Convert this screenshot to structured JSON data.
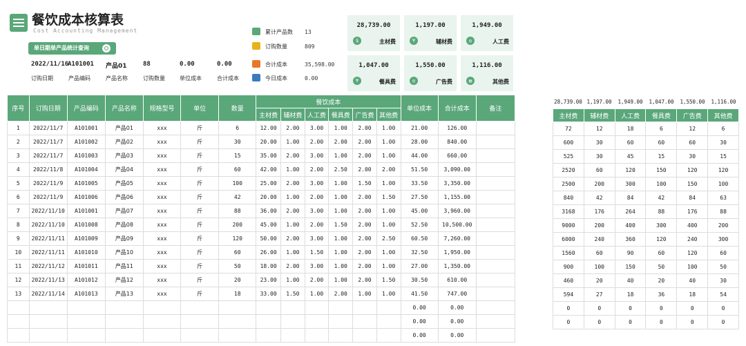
{
  "header": {
    "title": "餐饮成本核算表",
    "subtitle": "Cost Accounting Management",
    "query_button": "单日期单产品统计查询"
  },
  "query": {
    "date": "2022/11/16",
    "code": "A101001",
    "name": "产品01",
    "qty": "88",
    "unit_cost": "0.00",
    "total_cost": "0.00",
    "labels": [
      "订购日期",
      "产品编码",
      "产品名称",
      "订购数量",
      "单位成本",
      "合计成本"
    ]
  },
  "summary": [
    {
      "label": "累计产品数",
      "value": "13",
      "icon": "stack-icon",
      "color": "#5aa77a"
    },
    {
      "label": "订购数量",
      "value": "809",
      "icon": "box-icon",
      "color": "#e8b21a"
    },
    {
      "label": "合计成本",
      "value": "35,598.00",
      "icon": "cash-icon",
      "color": "#e8772a"
    },
    {
      "label": "今日成本",
      "value": "0.00",
      "icon": "truck-icon",
      "color": "#3a7bbf"
    }
  ],
  "cards": [
    {
      "value": "28,739.00",
      "label": "主材费",
      "glyph": "$"
    },
    {
      "value": "1,197.00",
      "label": "辅材费",
      "glyph": "¥"
    },
    {
      "value": "1,949.00",
      "label": "人工费",
      "glyph": "◎"
    },
    {
      "value": "1,047.00",
      "label": "餐具费",
      "glyph": "¥"
    },
    {
      "value": "1,550.00",
      "label": "广告费",
      "glyph": "◎"
    },
    {
      "value": "1,116.00",
      "label": "其他费",
      "glyph": "▤"
    }
  ],
  "table": {
    "headers": [
      "序号",
      "订购日期",
      "产品编码",
      "产品名称",
      "规格型号",
      "单位",
      "数量",
      "餐饮成本",
      "单位成本",
      "合计成本",
      "备注"
    ],
    "sub_headers": [
      "主材费",
      "辅材费",
      "人工费",
      "餐具费",
      "广告费",
      "其他费"
    ],
    "rows": [
      [
        "1",
        "2022/11/7",
        "A101001",
        "产品01",
        "xxx",
        "斤",
        "6",
        "12.00",
        "2.00",
        "3.00",
        "1.00",
        "2.00",
        "1.00",
        "21.00",
        "126.00",
        ""
      ],
      [
        "2",
        "2022/11/7",
        "A101002",
        "产品02",
        "xxx",
        "斤",
        "30",
        "20.00",
        "1.00",
        "2.00",
        "2.00",
        "2.00",
        "1.00",
        "28.00",
        "840.00",
        ""
      ],
      [
        "3",
        "2022/11/7",
        "A101003",
        "产品03",
        "xxx",
        "斤",
        "15",
        "35.00",
        "2.00",
        "3.00",
        "1.00",
        "2.00",
        "1.00",
        "44.00",
        "660.00",
        ""
      ],
      [
        "4",
        "2022/11/8",
        "A101004",
        "产品04",
        "xxx",
        "斤",
        "60",
        "42.00",
        "1.00",
        "2.00",
        "2.50",
        "2.00",
        "2.00",
        "51.50",
        "3,090.00",
        ""
      ],
      [
        "5",
        "2022/11/9",
        "A101005",
        "产品05",
        "xxx",
        "斤",
        "100",
        "25.00",
        "2.00",
        "3.00",
        "1.00",
        "1.50",
        "1.00",
        "33.50",
        "3,350.00",
        ""
      ],
      [
        "6",
        "2022/11/9",
        "A101006",
        "产品06",
        "xxx",
        "斤",
        "42",
        "20.00",
        "1.00",
        "2.00",
        "1.00",
        "2.00",
        "1.50",
        "27.50",
        "1,155.00",
        ""
      ],
      [
        "7",
        "2022/11/10",
        "A101001",
        "产品07",
        "xxx",
        "斤",
        "88",
        "36.00",
        "2.00",
        "3.00",
        "1.00",
        "2.00",
        "1.00",
        "45.00",
        "3,960.00",
        ""
      ],
      [
        "8",
        "2022/11/10",
        "A101008",
        "产品08",
        "xxx",
        "斤",
        "200",
        "45.00",
        "1.00",
        "2.00",
        "1.50",
        "2.00",
        "1.00",
        "52.50",
        "10,500.00",
        ""
      ],
      [
        "9",
        "2022/11/11",
        "A101009",
        "产品09",
        "xxx",
        "斤",
        "120",
        "50.00",
        "2.00",
        "3.00",
        "1.00",
        "2.00",
        "2.50",
        "60.50",
        "7,260.00",
        ""
      ],
      [
        "10",
        "2022/11/11",
        "A101010",
        "产品10",
        "xxx",
        "斤",
        "60",
        "26.00",
        "1.00",
        "1.50",
        "1.00",
        "2.00",
        "1.00",
        "32.50",
        "1,950.00",
        ""
      ],
      [
        "11",
        "2022/11/12",
        "A101011",
        "产品11",
        "xxx",
        "斤",
        "50",
        "18.00",
        "2.00",
        "3.00",
        "1.00",
        "2.00",
        "1.00",
        "27.00",
        "1,350.00",
        ""
      ],
      [
        "12",
        "2022/11/13",
        "A101012",
        "产品12",
        "xxx",
        "斤",
        "20",
        "23.00",
        "1.00",
        "2.00",
        "1.00",
        "2.00",
        "1.50",
        "30.50",
        "610.00",
        ""
      ],
      [
        "13",
        "2022/11/14",
        "A101013",
        "产品13",
        "xxx",
        "斤",
        "18",
        "33.00",
        "1.50",
        "1.00",
        "2.00",
        "1.00",
        "1.00",
        "41.50",
        "747.00",
        ""
      ],
      [
        "",
        "",
        "",
        "",
        "",
        "",
        "",
        "",
        "",
        "",
        "",
        "",
        "",
        "0.00",
        "0.00",
        ""
      ],
      [
        "",
        "",
        "",
        "",
        "",
        "",
        "",
        "",
        "",
        "",
        "",
        "",
        "",
        "0.00",
        "0.00",
        ""
      ],
      [
        "",
        "",
        "",
        "",
        "",
        "",
        "",
        "",
        "",
        "",
        "",
        "",
        "",
        "0.00",
        "0.00",
        ""
      ]
    ]
  },
  "side_table": {
    "totals": [
      "28,739.00",
      "1,197.00",
      "1,949.00",
      "1,047.00",
      "1,550.00",
      "1,116.00"
    ],
    "headers": [
      "主材费",
      "辅材费",
      "人工费",
      "餐具费",
      "广告费",
      "其他费"
    ],
    "rows": [
      [
        "72",
        "12",
        "18",
        "6",
        "12",
        "6"
      ],
      [
        "600",
        "30",
        "60",
        "60",
        "60",
        "30"
      ],
      [
        "525",
        "30",
        "45",
        "15",
        "30",
        "15"
      ],
      [
        "2520",
        "60",
        "120",
        "150",
        "120",
        "120"
      ],
      [
        "2500",
        "200",
        "300",
        "100",
        "150",
        "100"
      ],
      [
        "840",
        "42",
        "84",
        "42",
        "84",
        "63"
      ],
      [
        "3168",
        "176",
        "264",
        "88",
        "176",
        "88"
      ],
      [
        "9000",
        "200",
        "400",
        "300",
        "400",
        "200"
      ],
      [
        "6000",
        "240",
        "360",
        "120",
        "240",
        "300"
      ],
      [
        "1560",
        "60",
        "90",
        "60",
        "120",
        "60"
      ],
      [
        "900",
        "100",
        "150",
        "50",
        "100",
        "50"
      ],
      [
        "460",
        "20",
        "40",
        "20",
        "40",
        "30"
      ],
      [
        "594",
        "27",
        "18",
        "36",
        "18",
        "54"
      ],
      [
        "0",
        "0",
        "0",
        "0",
        "0",
        "0"
      ],
      [
        "0",
        "0",
        "0",
        "0",
        "0",
        "0"
      ]
    ]
  }
}
